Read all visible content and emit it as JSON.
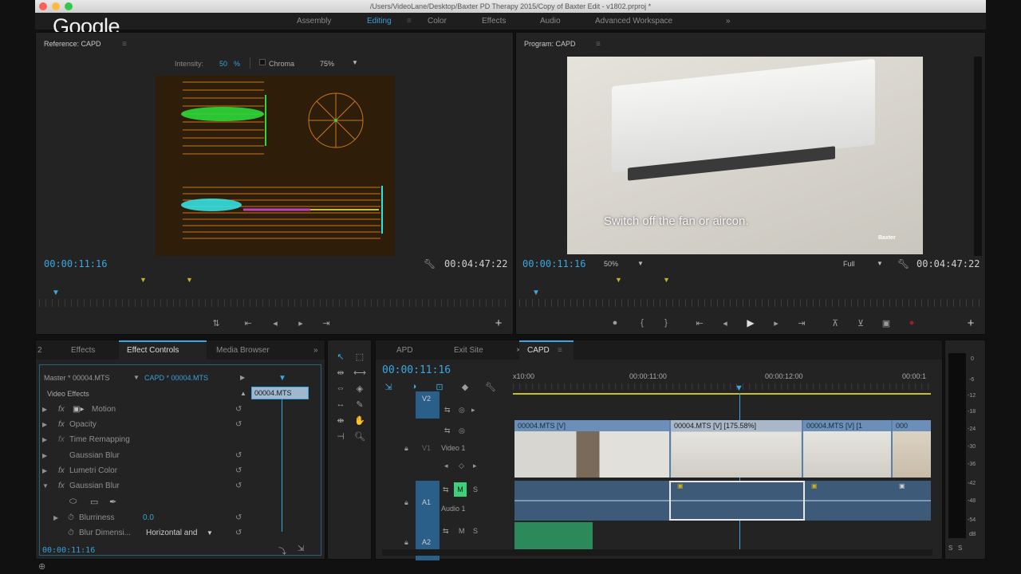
{
  "window": {
    "title": "/Users/VideoLane/Desktop/Baxter PD Therapy 2015/Copy of Baxter Edit - v1802.prproj *"
  },
  "overlay": {
    "logo": "Google"
  },
  "workspaces": [
    "Assembly",
    "Editing",
    "Color",
    "Effects",
    "Audio",
    "Advanced Workspace"
  ],
  "workspaces_more": "»",
  "reference": {
    "title": "Reference: CAPD",
    "intensity_label": "Intensity:",
    "intensity_value": "50",
    "intensity_unit": "%",
    "chroma_label": "Chroma",
    "zoom": "75%",
    "timecode_left": "00:00:11:16",
    "timecode_right": "00:04:47:22"
  },
  "program": {
    "title": "Program: CAPD",
    "subtitle": "Switch off the fan or aircon.",
    "watermark": "Baxter",
    "timecode_left": "00:00:11:16",
    "zoom": "50%",
    "quality": "Full",
    "timecode_right": "00:04:47:22"
  },
  "effects_panel": {
    "tabs": [
      "2",
      "Effects",
      "Effect Controls",
      "Media Browser"
    ],
    "tabs_more": "»",
    "master": "Master * 00004.MTS",
    "sequence": "CAPD * 00004.MTS",
    "clip_label": "00004.MTS",
    "section": "Video Effects",
    "rows": [
      "Motion",
      "Opacity",
      "Time Remapping",
      "Gaussian Blur",
      "Lumetri Color",
      "Gaussian Blur"
    ],
    "blurriness_label": "Blurriness",
    "blurriness_value": "0.0",
    "blur_dim_label": "Blur Dimensi...",
    "blur_dim_value": "Horizontal and",
    "timecode": "00:00:11:16"
  },
  "timeline": {
    "tabs": [
      "APD",
      "Exit Site",
      "CAPD"
    ],
    "timecode": "00:00:11:16",
    "ruler": [
      "x10:00",
      "00:00:11:00",
      "00:00:12:00",
      "00:00:1"
    ],
    "tracks": {
      "v2": "V2",
      "v1": "V1",
      "v1_name": "Video 1",
      "a1": "A1",
      "a1_name": "Audio 1",
      "a2": "A2",
      "m": "M",
      "s": "S"
    },
    "clips": [
      "00004.MTS [V]",
      "00004.MTS [V] [175.58%]",
      "00004.MTS [V] [1",
      "000"
    ]
  },
  "meter": {
    "labels": [
      "0",
      "-6",
      "-12",
      "-18",
      "-24",
      "-30",
      "-36",
      "-42",
      "-48",
      "-54",
      "dB"
    ],
    "solo": "S"
  },
  "colors": {
    "accent": "#39a8e0",
    "green": "#2cd83a",
    "cyan": "#35e0e0",
    "panel": "#232323"
  }
}
